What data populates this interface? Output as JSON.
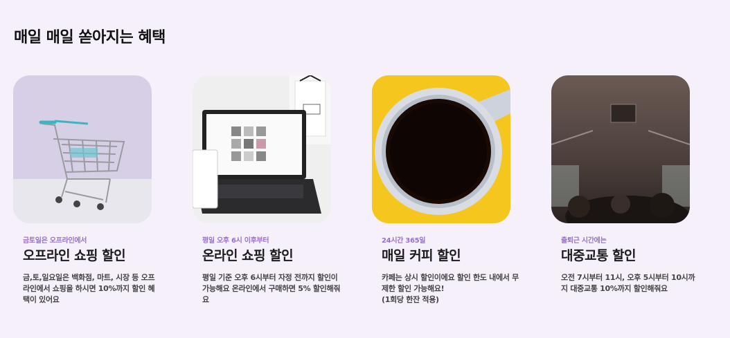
{
  "section": {
    "title": "매일 매일 쏟아지는 혜택"
  },
  "cards": [
    {
      "image": "shopping-cart-photo",
      "tag": "금토일은 오프라인에서",
      "name": "오프라인 쇼핑 할인",
      "desc": "금,토,일요일은 백화점, 마트, 시장 등 오프라인에서 쇼핑을 하시면 10%까지 할인 혜택이 있어요"
    },
    {
      "image": "laptop-photo",
      "tag": "평일 오후 6시 이후부터",
      "name": "온라인 쇼핑 할인",
      "desc": "평일 기준 오후 6시부터 자정 전까지 할인이 가능해요 온라인에서 구매하면 5% 할인해줘요"
    },
    {
      "image": "coffee-cup-photo",
      "tag": "24시간 365일",
      "name": "매일 커피 할인",
      "desc": "카페는 상시 할인이에요 할인 한도 내에서 무제한 할인 가능해요!\n(1회당 한잔 적용)"
    },
    {
      "image": "subway-photo",
      "tag": "출퇴근 시간에는",
      "name": "대중교통 할인",
      "desc": "오전 7시부터 11시, 오후 5시부터 10시까지 대중교통 10%까지 할인해줘요"
    }
  ]
}
